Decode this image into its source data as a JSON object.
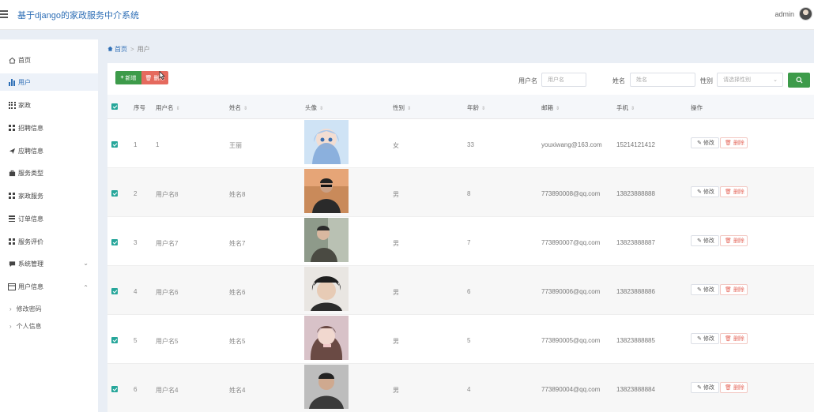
{
  "header": {
    "title": "基于django的家政服务中介系统",
    "user": "admin"
  },
  "sidebar": {
    "items": [
      {
        "label": "首页",
        "icon": "home-icon"
      },
      {
        "label": "用户",
        "icon": "bar-chart-icon"
      },
      {
        "label": "家政",
        "icon": "grid-icon"
      },
      {
        "label": "招聘信息",
        "icon": "grid-icon"
      },
      {
        "label": "应聘信息",
        "icon": "send-icon"
      },
      {
        "label": "服务类型",
        "icon": "briefcase-icon"
      },
      {
        "label": "家政服务",
        "icon": "grid-icon"
      },
      {
        "label": "订单信息",
        "icon": "list-icon"
      },
      {
        "label": "服务评价",
        "icon": "grid-icon"
      },
      {
        "label": "系统管理",
        "icon": "chat-icon"
      },
      {
        "label": "用户信息",
        "icon": "window-icon"
      }
    ],
    "sub_items": [
      {
        "label": "修改密码"
      },
      {
        "label": "个人信息"
      }
    ]
  },
  "breadcrumb": {
    "home": "首页",
    "sep": ">",
    "current": "用户"
  },
  "toolbar": {
    "add_label": "新增",
    "delete_label": "删除"
  },
  "search": {
    "username_label": "用户名",
    "username_placeholder": "用户名",
    "name_label": "姓名",
    "name_placeholder": "姓名",
    "gender_label": "性别",
    "gender_placeholder": "请选择性别"
  },
  "table": {
    "columns": [
      "序号",
      "用户名",
      "姓名",
      "头像",
      "性别",
      "年龄",
      "邮箱",
      "手机",
      "操作"
    ],
    "edit_label": "修改",
    "remove_label": "删除",
    "rows": [
      {
        "index": "1",
        "username": "1",
        "name": "王丽",
        "gender": "女",
        "age": "33",
        "email": "youxiwang@163.com",
        "phone": "15214121412"
      },
      {
        "index": "2",
        "username": "用户名8",
        "name": "姓名8",
        "gender": "男",
        "age": "8",
        "email": "773890008@qq.com",
        "phone": "13823888888"
      },
      {
        "index": "3",
        "username": "用户名7",
        "name": "姓名7",
        "gender": "男",
        "age": "7",
        "email": "773890007@qq.com",
        "phone": "13823888887"
      },
      {
        "index": "4",
        "username": "用户名6",
        "name": "姓名6",
        "gender": "男",
        "age": "6",
        "email": "773890006@qq.com",
        "phone": "13823888886"
      },
      {
        "index": "5",
        "username": "用户名5",
        "name": "姓名5",
        "gender": "男",
        "age": "5",
        "email": "773890005@qq.com",
        "phone": "13823888885"
      },
      {
        "index": "6",
        "username": "用户名4",
        "name": "姓名4",
        "gender": "男",
        "age": "4",
        "email": "773890004@qq.com",
        "phone": "13823888884"
      }
    ]
  },
  "colors": {
    "primary": "#2f6fb6",
    "success": "#3d9b4a",
    "danger": "#e56a5e",
    "checkbox": "#26a69a"
  }
}
